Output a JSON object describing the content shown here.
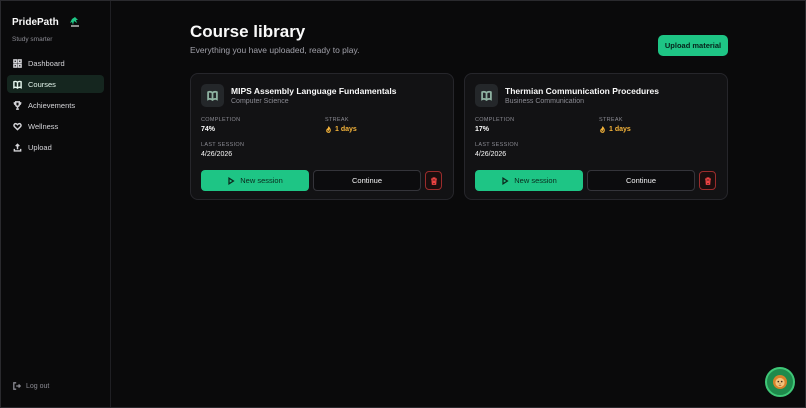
{
  "brand": {
    "name": "PridePath",
    "tagline": "Study smarter"
  },
  "sidebar": {
    "items": [
      {
        "label": "Dashboard",
        "icon": "dashboard-icon",
        "active": false
      },
      {
        "label": "Courses",
        "icon": "book-icon",
        "active": true
      },
      {
        "label": "Achievements",
        "icon": "trophy-icon",
        "active": false
      },
      {
        "label": "Wellness",
        "icon": "heart-icon",
        "active": false
      },
      {
        "label": "Upload",
        "icon": "upload-icon",
        "active": false
      }
    ],
    "logout_label": "Log out"
  },
  "header": {
    "title": "Course library",
    "subtitle": "Everything you have uploaded, ready to play.",
    "upload_label": "Upload material"
  },
  "labels": {
    "completion": "COMPLETION",
    "streak": "STREAK",
    "last_session": "LAST SESSION",
    "new_session": "New session",
    "continue": "Continue"
  },
  "courses": [
    {
      "title": "MIPS Assembly Language Fundamentals",
      "category": "Computer Science",
      "completion": "74%",
      "streak": "1 days",
      "last_session": "4/26/2026"
    },
    {
      "title": "Thermian Communication Procedures",
      "category": "Business Communication",
      "completion": "17%",
      "streak": "1 days",
      "last_session": "4/26/2026"
    }
  ],
  "colors": {
    "accent": "#1ec585",
    "background": "#0a0a0b",
    "card": "#121214",
    "streak": "#f5b43a",
    "danger": "#ef4444"
  }
}
